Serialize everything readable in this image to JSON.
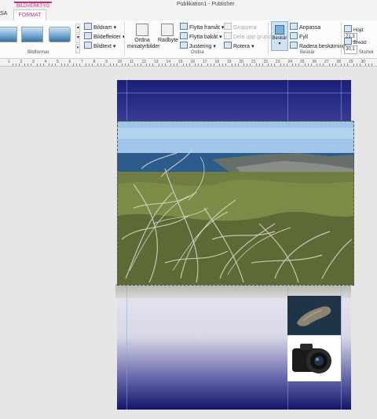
{
  "window": {
    "title": "Publikation1 - Publisher",
    "context_tab": "BILDVERKTYG"
  },
  "tabs": {
    "left_partial": "SA",
    "active": "FORMAT"
  },
  "ribbon": {
    "bildformat": {
      "label": "Bildformat",
      "items": [
        "Bildram",
        "Bildeffekter",
        "Bildtext"
      ]
    },
    "ordna": {
      "label": "Ordna",
      "ordna_miniatyrbilder": "Ordna miniatyrbilder",
      "radbyte": "Radbyte",
      "items": [
        "Flytta framåt",
        "Flytta bakåt",
        "Justering",
        "Gruppera",
        "Dela upp grupp",
        "Rotera"
      ]
    },
    "beskar": {
      "label": "Beskär",
      "button": "Beskär",
      "items": [
        "Anpassa",
        "Fyll",
        "Radera beskärning"
      ]
    },
    "storlek": {
      "label": "Storlek",
      "hojd_label": "Höjd:",
      "hojd_value": "21,3",
      "bredd_label": "Bredd:",
      "bredd_value": "30,1"
    }
  },
  "ruler": {
    "numbers": [
      "1",
      "2",
      "3",
      "4",
      "5",
      "6",
      "7",
      "8",
      "9",
      "10",
      "11",
      "12",
      "13",
      "14",
      "15",
      "16",
      "17",
      "18",
      "19",
      "20",
      "21",
      "22",
      "23",
      "24",
      "25",
      "26",
      "27",
      "28",
      "29",
      "30"
    ]
  },
  "icons": [
    "picture-style-thumbnail-icon",
    "picture-border-icon",
    "picture-effects-icon",
    "caption-icon",
    "arrange-thumbnails-icon",
    "wrap-text-icon",
    "bring-forward-icon",
    "send-backward-icon",
    "align-icon",
    "group-icon",
    "ungroup-icon",
    "rotate-icon",
    "crop-icon",
    "fit-icon",
    "fill-icon",
    "clear-crop-icon",
    "height-icon",
    "width-icon"
  ]
}
